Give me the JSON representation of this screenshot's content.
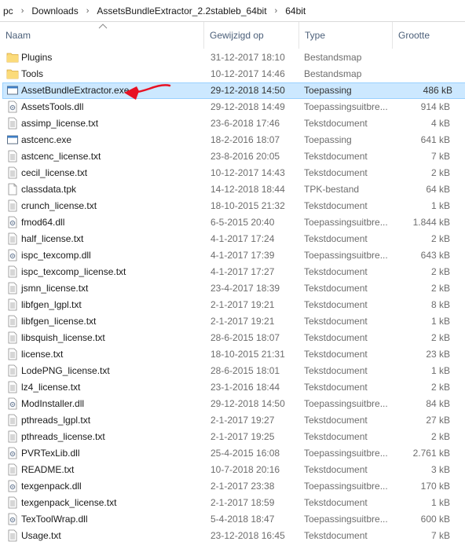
{
  "breadcrumb": [
    "pc",
    "Downloads",
    "AssetsBundleExtractor_2.2stableb_64bit",
    "64bit"
  ],
  "columns": {
    "name": "Naam",
    "date": "Gewijzigd op",
    "type": "Type",
    "size": "Grootte"
  },
  "accent": {
    "selection_bg": "#cce8ff",
    "selection_border": "#99d1ff",
    "header_text": "#4c607a",
    "annotation": "#e81123"
  },
  "files": [
    {
      "name": "Plugins",
      "date": "31-12-2017 18:10",
      "type": "Bestandsmap",
      "size": "",
      "icon": "folder-icon"
    },
    {
      "name": "Tools",
      "date": "10-12-2017 14:46",
      "type": "Bestandsmap",
      "size": "",
      "icon": "folder-icon"
    },
    {
      "name": "AssetBundleExtractor.exe",
      "date": "29-12-2018 14:50",
      "type": "Toepassing",
      "size": "486 kB",
      "icon": "exe-icon",
      "selected": true
    },
    {
      "name": "AssetsTools.dll",
      "date": "29-12-2018 14:49",
      "type": "Toepassingsuitbre...",
      "size": "914 kB",
      "icon": "dll-icon"
    },
    {
      "name": "assimp_license.txt",
      "date": "23-6-2018 17:46",
      "type": "Tekstdocument",
      "size": "4 kB",
      "icon": "txt-icon"
    },
    {
      "name": "astcenc.exe",
      "date": "18-2-2016 18:07",
      "type": "Toepassing",
      "size": "641 kB",
      "icon": "exe-icon"
    },
    {
      "name": "astcenc_license.txt",
      "date": "23-8-2016 20:05",
      "type": "Tekstdocument",
      "size": "7 kB",
      "icon": "txt-icon"
    },
    {
      "name": "cecil_license.txt",
      "date": "10-12-2017 14:43",
      "type": "Tekstdocument",
      "size": "2 kB",
      "icon": "txt-icon"
    },
    {
      "name": "classdata.tpk",
      "date": "14-12-2018 18:44",
      "type": "TPK-bestand",
      "size": "64 kB",
      "icon": "file-icon"
    },
    {
      "name": "crunch_license.txt",
      "date": "18-10-2015 21:32",
      "type": "Tekstdocument",
      "size": "1 kB",
      "icon": "txt-icon"
    },
    {
      "name": "fmod64.dll",
      "date": "6-5-2015 20:40",
      "type": "Toepassingsuitbre...",
      "size": "1.844 kB",
      "icon": "dll-icon"
    },
    {
      "name": "half_license.txt",
      "date": "4-1-2017 17:24",
      "type": "Tekstdocument",
      "size": "2 kB",
      "icon": "txt-icon"
    },
    {
      "name": "ispc_texcomp.dll",
      "date": "4-1-2017 17:39",
      "type": "Toepassingsuitbre...",
      "size": "643 kB",
      "icon": "dll-icon"
    },
    {
      "name": "ispc_texcomp_license.txt",
      "date": "4-1-2017 17:27",
      "type": "Tekstdocument",
      "size": "2 kB",
      "icon": "txt-icon"
    },
    {
      "name": "jsmn_license.txt",
      "date": "23-4-2017 18:39",
      "type": "Tekstdocument",
      "size": "2 kB",
      "icon": "txt-icon"
    },
    {
      "name": "libfgen_lgpl.txt",
      "date": "2-1-2017 19:21",
      "type": "Tekstdocument",
      "size": "8 kB",
      "icon": "txt-icon"
    },
    {
      "name": "libfgen_license.txt",
      "date": "2-1-2017 19:21",
      "type": "Tekstdocument",
      "size": "1 kB",
      "icon": "txt-icon"
    },
    {
      "name": "libsquish_license.txt",
      "date": "28-6-2015 18:07",
      "type": "Tekstdocument",
      "size": "2 kB",
      "icon": "txt-icon"
    },
    {
      "name": "license.txt",
      "date": "18-10-2015 21:31",
      "type": "Tekstdocument",
      "size": "23 kB",
      "icon": "txt-icon"
    },
    {
      "name": "LodePNG_license.txt",
      "date": "28-6-2015 18:01",
      "type": "Tekstdocument",
      "size": "1 kB",
      "icon": "txt-icon"
    },
    {
      "name": "lz4_license.txt",
      "date": "23-1-2016 18:44",
      "type": "Tekstdocument",
      "size": "2 kB",
      "icon": "txt-icon"
    },
    {
      "name": "ModInstaller.dll",
      "date": "29-12-2018 14:50",
      "type": "Toepassingsuitbre...",
      "size": "84 kB",
      "icon": "dll-icon"
    },
    {
      "name": "pthreads_lgpl.txt",
      "date": "2-1-2017 19:27",
      "type": "Tekstdocument",
      "size": "27 kB",
      "icon": "txt-icon"
    },
    {
      "name": "pthreads_license.txt",
      "date": "2-1-2017 19:25",
      "type": "Tekstdocument",
      "size": "2 kB",
      "icon": "txt-icon"
    },
    {
      "name": "PVRTexLib.dll",
      "date": "25-4-2015 16:08",
      "type": "Toepassingsuitbre...",
      "size": "2.761 kB",
      "icon": "dll-icon"
    },
    {
      "name": "README.txt",
      "date": "10-7-2018 20:16",
      "type": "Tekstdocument",
      "size": "3 kB",
      "icon": "txt-icon"
    },
    {
      "name": "texgenpack.dll",
      "date": "2-1-2017 23:38",
      "type": "Toepassingsuitbre...",
      "size": "170 kB",
      "icon": "dll-icon"
    },
    {
      "name": "texgenpack_license.txt",
      "date": "2-1-2017 18:59",
      "type": "Tekstdocument",
      "size": "1 kB",
      "icon": "txt-icon"
    },
    {
      "name": "TexToolWrap.dll",
      "date": "5-4-2018 18:47",
      "type": "Toepassingsuitbre...",
      "size": "600 kB",
      "icon": "dll-icon"
    },
    {
      "name": "Usage.txt",
      "date": "23-12-2018 16:45",
      "type": "Tekstdocument",
      "size": "7 kB",
      "icon": "txt-icon"
    }
  ]
}
